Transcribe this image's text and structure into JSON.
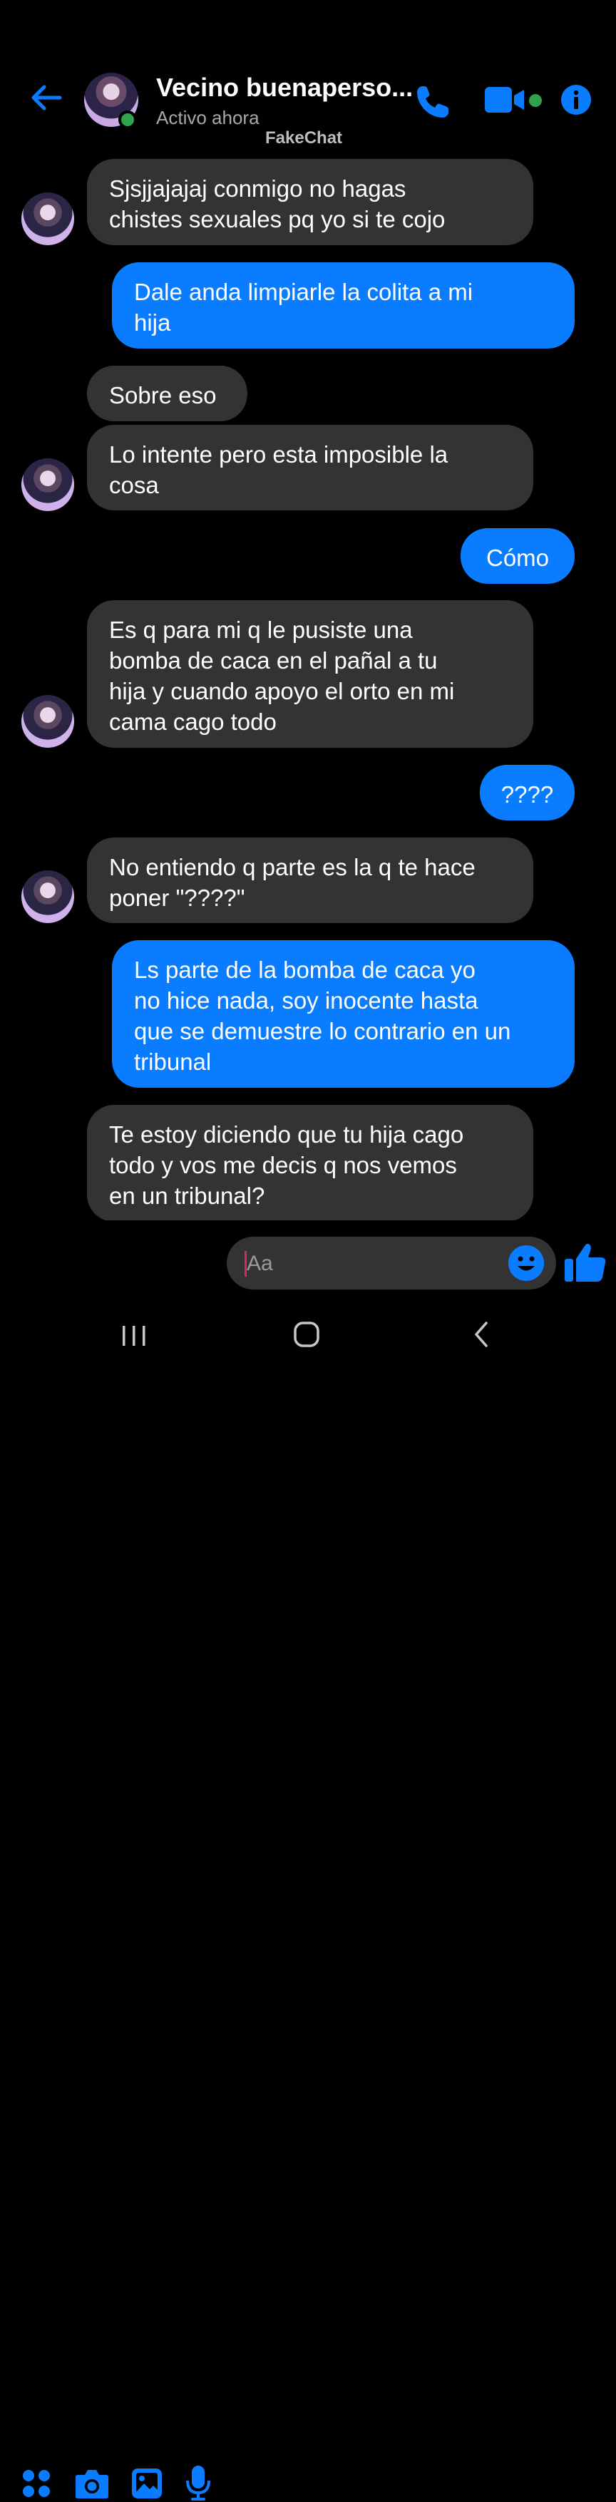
{
  "header": {
    "contact_name": "Vecino buenaperso...",
    "status": "Activo ahora",
    "watermark": "FakeChat"
  },
  "messages": [
    {
      "dir": "in",
      "lines": [
        "Sjsjjajajaj conmigo no hagas",
        "chistes sexuales pq yo si te cojo"
      ]
    },
    {
      "dir": "out",
      "lines": [
        "Dale anda limpiarle la colita a mi",
        "hija"
      ]
    },
    {
      "dir": "in",
      "lines": [
        "Sobre eso"
      ]
    },
    {
      "dir": "in",
      "lines": [
        "Lo intente pero esta imposible la",
        "cosa"
      ]
    },
    {
      "dir": "out",
      "lines": [
        "Cómo"
      ]
    },
    {
      "dir": "in",
      "lines": [
        "Es q para mi q le pusiste una",
        "bomba de caca en el pañal a tu",
        "hija y cuando apoyo el orto en mi",
        "cama cago todo"
      ]
    },
    {
      "dir": "out",
      "lines": [
        "????"
      ]
    },
    {
      "dir": "in",
      "lines": [
        "No entiendo q parte es la q te hace",
        "poner \"????\""
      ]
    },
    {
      "dir": "out",
      "lines": [
        "Ls parte de la bomba de caca yo",
        "no hice nada, soy inocente hasta",
        "que se demuestre lo contrario en un",
        "tribunal"
      ]
    },
    {
      "dir": "in",
      "lines": [
        "Te estoy diciendo que tu hija cago",
        "todo y vos me decis q nos vemos",
        "en un tribunal?"
      ]
    }
  ],
  "composer": {
    "placeholder": "Aa",
    "icons": [
      "apps-icon",
      "camera-icon",
      "image-icon",
      "microphone-icon",
      "emoji-icon",
      "thumbs-up-icon"
    ]
  },
  "colors": {
    "accent": "#0a7cff",
    "incoming_bubble": "#333334",
    "online": "#31a24c",
    "background": "#000000"
  }
}
